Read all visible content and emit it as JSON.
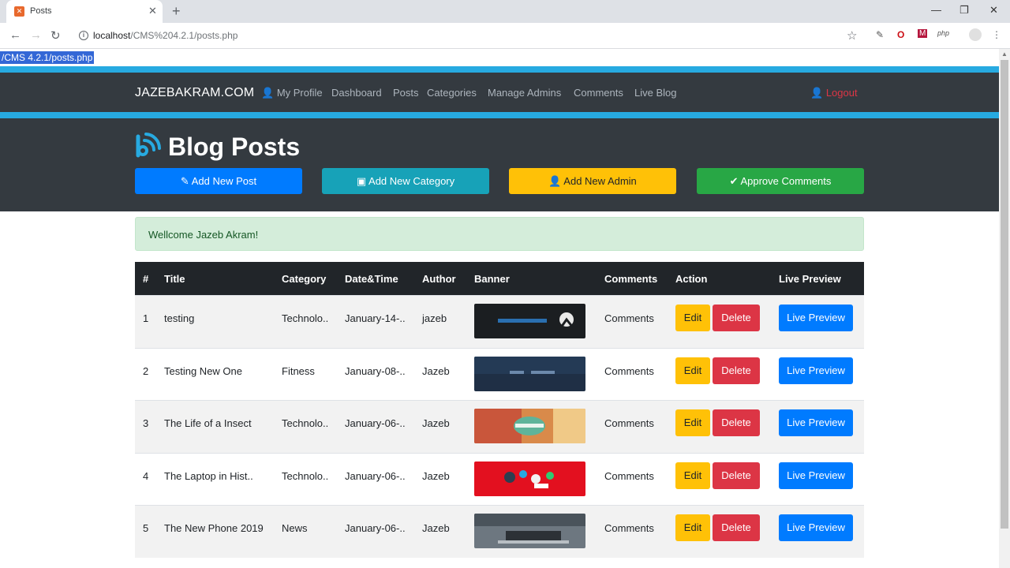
{
  "browser": {
    "tab_title": "Posts",
    "url_host": "localhost",
    "url_path": "/CMS%204.2.1/posts.php",
    "selected_text": "/CMS 4.2.1/posts.php"
  },
  "navbar": {
    "brand": "JAZEBAKRAM.COM",
    "links": [
      "My Profile",
      "Dashboard",
      "Posts",
      "Categories",
      "Manage Admins",
      "Comments",
      "Live Blog"
    ],
    "logout": "Logout"
  },
  "header": {
    "title": "Blog Posts",
    "buttons": {
      "add_post": "Add New Post",
      "add_category": "Add New Category",
      "add_admin": "Add New Admin",
      "approve_comments": "Approve Comments"
    }
  },
  "alert": {
    "message": "Wellcome Jazeb Akram!"
  },
  "table": {
    "headers": [
      "#",
      "Title",
      "Category",
      "Date&Time",
      "Author",
      "Banner",
      "Comments",
      "Action",
      "Live Preview"
    ],
    "rows": [
      {
        "num": "1",
        "title": "testing",
        "category": "Technolo..",
        "date": "January-14-..",
        "author": "jazeb",
        "comments": "Comments",
        "edit": "Edit",
        "delete": "Delete",
        "preview": "Live Preview"
      },
      {
        "num": "2",
        "title": "Testing New One",
        "category": "Fitness",
        "date": "January-08-..",
        "author": "Jazeb",
        "comments": "Comments",
        "edit": "Edit",
        "delete": "Delete",
        "preview": "Live Preview"
      },
      {
        "num": "3",
        "title": "The Life of a Insect",
        "category": "Technolo..",
        "date": "January-06-..",
        "author": "Jazeb",
        "comments": "Comments",
        "edit": "Edit",
        "delete": "Delete",
        "preview": "Live Preview"
      },
      {
        "num": "4",
        "title": "The Laptop in Hist..",
        "category": "Technolo..",
        "date": "January-06-..",
        "author": "Jazeb",
        "comments": "Comments",
        "edit": "Edit",
        "delete": "Delete",
        "preview": "Live Preview"
      },
      {
        "num": "5",
        "title": "The New Phone 2019",
        "category": "News",
        "date": "January-06-..",
        "author": "Jazeb",
        "comments": "Comments",
        "edit": "Edit",
        "delete": "Delete",
        "preview": "Live Preview"
      }
    ]
  },
  "colors": {
    "accent_stripe": "#27aae1",
    "navbar": "#343a40",
    "primary": "#007bff",
    "info": "#17a2b8",
    "warning": "#ffc107",
    "success": "#28a745",
    "danger": "#dc3545"
  }
}
